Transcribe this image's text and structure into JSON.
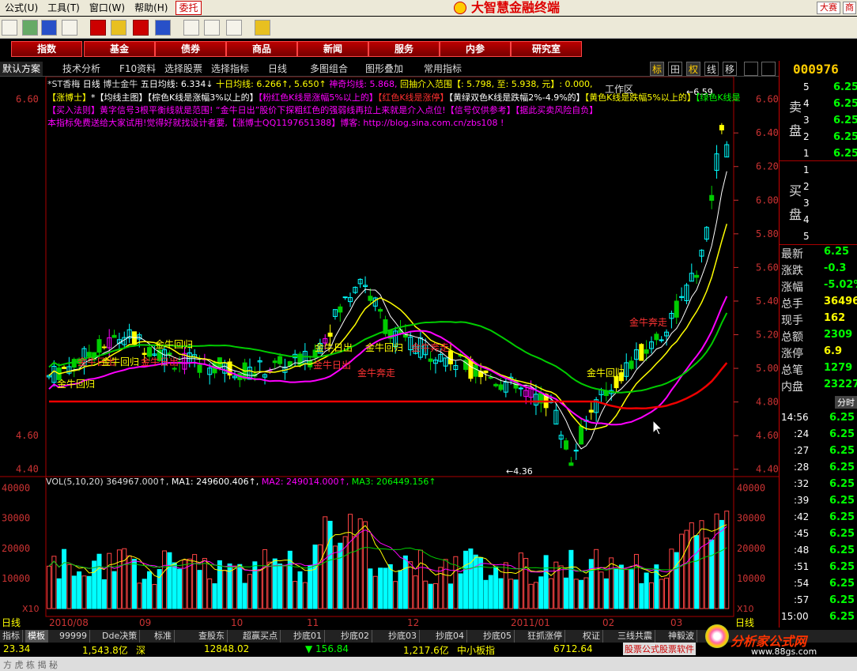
{
  "menu": {
    "items": [
      "公式(U)",
      "工具(T)",
      "窗口(W)",
      "帮助(H)"
    ],
    "entrust": "委托",
    "app_title": "大智慧金融终端",
    "contest": "大赛",
    "biz": "商"
  },
  "nav": {
    "buttons": [
      "指数",
      "基金",
      "债券",
      "商品",
      "新闻",
      "服务",
      "内参",
      "研究室"
    ],
    "workzone": "工作区"
  },
  "tabs": {
    "items": [
      "默认方案",
      "技术分析",
      "F10资料",
      "选择股票",
      "选择指标",
      "日线",
      "多图组合",
      "图形叠加",
      "常用指标"
    ],
    "right_tabs": [
      "标",
      "田",
      "权",
      "线",
      "移",
      "",
      ""
    ]
  },
  "indicator": {
    "line1_name": "*ST香梅",
    "line1_period": "日线",
    "line1_ind": "博士金牛",
    "line1_ma5": "五日均线: 6.334↓",
    "line1_ma10": "十日均线: 6.266↑, 5.650↑",
    "line1_sq": "神奇均线: 5.868,",
    "line1_range": "回抽介入范围【: 5.798, 至: 5.938, 元】: 0.000,",
    "line2": [
      {
        "text": "【涨博士】",
        "color": "#ffff00"
      },
      {
        "text": "*【均线主图】",
        "color": "#ffffff"
      },
      {
        "text": "【棕色K线是涨幅3%以上的】",
        "color": "#ffffff"
      },
      {
        "text": "【粉红色K线是涨幅5%以上的】",
        "color": "#ff00ff"
      },
      {
        "text": "【红色K线是涨停】",
        "color": "#ff3030"
      },
      {
        "text": "【黄绿双色K线是跌幅2%-4.9%的】",
        "color": "#ffffff"
      },
      {
        "text": "【黄色K线是跌幅5%以上的】",
        "color": "#ffff00"
      },
      {
        "text": "【绿色K线是",
        "color": "#00ff00"
      }
    ],
    "line3": "【买入法则】黄字信号3根平衡线就是范围! “金牛日出”股价下探粗红色的强弱线再拉上来就是介入点位!【信号仅供参考】【据此买卖风险自负】",
    "line4": "本指标免费送给大家试用!觉得好就找设计者要,【涨博士QQ1197651388】博客: http://blog.sina.com.cn/zbs108 !"
  },
  "price_axis": {
    "labels": [
      "6.60",
      "6.40",
      "6.20",
      "6.00",
      "5.80",
      "5.60",
      "5.40",
      "5.20",
      "5.00",
      "4.80",
      "4.60",
      "4.40"
    ],
    "left_labels": [
      "6.60",
      "4.60",
      "4.40"
    ]
  },
  "vol_axis": {
    "labels": [
      "40000",
      "30000",
      "20000",
      "10000"
    ],
    "unit": "X10"
  },
  "vol_legend": {
    "vol": "VOL(5,10,20)  364967.000↑,",
    "ma1": "MA1: 249600.406↑,",
    "ma2": "MA2: 249014.000↑,",
    "ma3": "MA3: 206449.156↑"
  },
  "date_axis": {
    "labels": [
      "2010/08",
      "09",
      "10",
      "11",
      "12",
      "2011/01",
      "02",
      "03"
    ],
    "period": "日线"
  },
  "chart_annotations": {
    "low": "4.36",
    "high": "6.59",
    "signals": [
      "金牛回归",
      "金牛日出",
      "金牛回归",
      "金牛日出",
      "金牛回归",
      "金牛日出",
      "金牛日出",
      "金牛奔走",
      "金牛回归",
      "金牛奔走",
      "金牛回归",
      "金牛奔走"
    ]
  },
  "quote": {
    "code": "000976",
    "sell_label": "卖盘",
    "buy_label": "买盘",
    "sell": [
      {
        "lvl": "5",
        "price": "6.25"
      },
      {
        "lvl": "4",
        "price": "6.25"
      },
      {
        "lvl": "3",
        "price": "6.25"
      },
      {
        "lvl": "2",
        "price": "6.25"
      },
      {
        "lvl": "1",
        "price": "6.25"
      }
    ],
    "buy": [
      {
        "lvl": "1",
        "price": ""
      },
      {
        "lvl": "2",
        "price": ""
      },
      {
        "lvl": "3",
        "price": ""
      },
      {
        "lvl": "4",
        "price": ""
      },
      {
        "lvl": "5",
        "price": ""
      }
    ],
    "stats": [
      {
        "label": "最新",
        "value": "6.25"
      },
      {
        "label": "涨跌",
        "value": "-0.3"
      },
      {
        "label": "涨幅",
        "value": "-5.02%"
      },
      {
        "label": "总手",
        "value": "36496"
      },
      {
        "label": "现手",
        "value": "162"
      },
      {
        "label": "总额",
        "value": "2309"
      },
      {
        "label": "涨停",
        "value": "6.9"
      },
      {
        "label": "总笔",
        "value": "1279"
      },
      {
        "label": "内盘",
        "value": "23227"
      }
    ],
    "tick_header": "分时",
    "ticks": [
      {
        "time": "14:56",
        "price": "6.25"
      },
      {
        "time": ":24",
        "price": "6.25"
      },
      {
        "time": ":27",
        "price": "6.25"
      },
      {
        "time": ":28",
        "price": "6.25"
      },
      {
        "time": ":32",
        "price": "6.25"
      },
      {
        "time": ":39",
        "price": "6.25"
      },
      {
        "time": ":42",
        "price": "6.25"
      },
      {
        "time": ":45",
        "price": "6.25"
      },
      {
        "time": ":48",
        "price": "6.25"
      },
      {
        "time": ":51",
        "price": "6.25"
      },
      {
        "time": ":54",
        "price": "6.25"
      },
      {
        "time": ":57",
        "price": "6.25"
      },
      {
        "time": "15:00",
        "price": "6.25"
      }
    ]
  },
  "bottom_tabs": [
    "指标",
    "模板",
    "99999",
    "Dde决策",
    "标准",
    "查股东",
    "超赢买点",
    "抄底01",
    "抄底02",
    "抄底03",
    "抄底04",
    "抄底05",
    "狂抓涨停",
    "权证",
    "三线共震",
    "神毅波"
  ],
  "status": {
    "v1": "23.34",
    "v2": "1,543.8亿",
    "m2": "深",
    "v3": "12848.02",
    "v4": "▼ 156.84",
    "v5": "1,217.6亿",
    "m5": "中小板指",
    "v6": "6712.64",
    "ad": "股票公式股票软件",
    "brand": "分析家公式网",
    "brand_url": "www.88gs.com"
  },
  "footer": "方 虎 栋 揭 秘",
  "chart_data": {
    "type": "candlestick",
    "price_range": [
      4.3,
      6.65
    ],
    "ma_labels": [
      "五日均线",
      "十日均线",
      "神奇均线"
    ],
    "volume_range": [
      0,
      42000
    ],
    "low": 4.36,
    "high": 6.59,
    "last": 6.25
  }
}
